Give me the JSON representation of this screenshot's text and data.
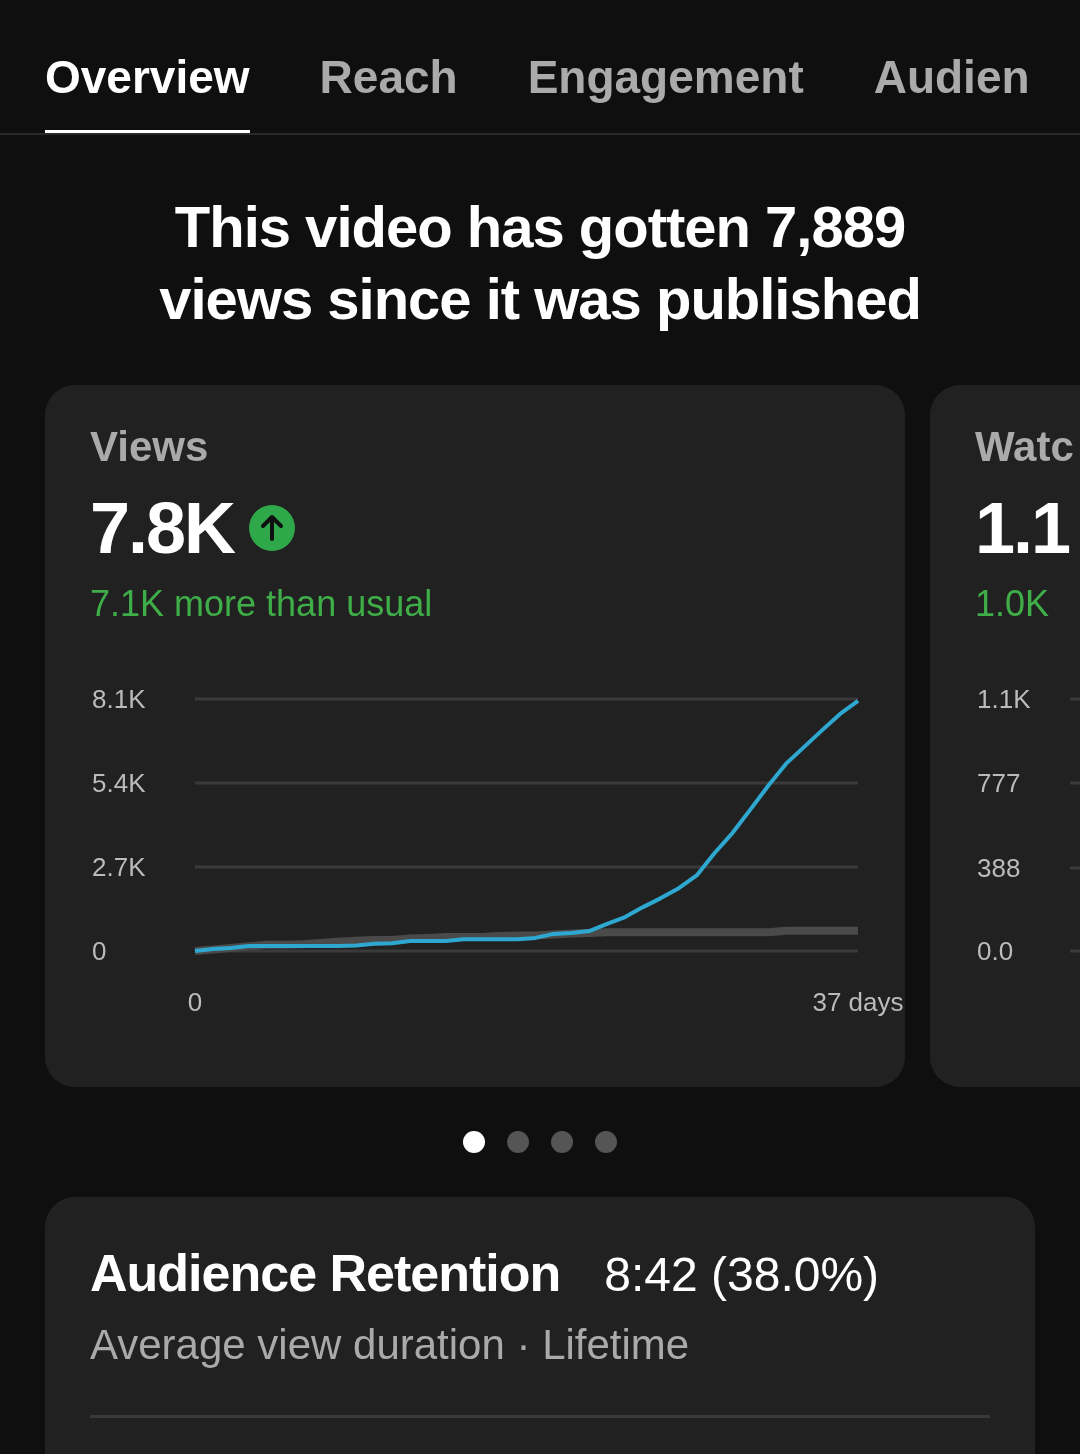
{
  "tabs": [
    {
      "label": "Overview",
      "selected": true
    },
    {
      "label": "Reach",
      "selected": false
    },
    {
      "label": "Engagement",
      "selected": false
    },
    {
      "label": "Audien",
      "selected": false
    }
  ],
  "headline": "This video has gotten 7,889 views since it was published",
  "cards": [
    {
      "title": "Views",
      "value": "7.8K",
      "rising": true,
      "comparison": "7.1K more than usual",
      "chart_data": {
        "type": "line",
        "x": [
          0,
          1,
          2,
          3,
          4,
          5,
          6,
          7,
          8,
          9,
          10,
          11,
          12,
          13,
          14,
          15,
          16,
          17,
          18,
          19,
          20,
          21,
          22,
          23,
          24,
          25,
          26,
          27,
          28,
          29,
          30,
          31,
          32,
          33,
          34,
          35,
          36,
          37
        ],
        "xlim": [
          0,
          37
        ],
        "ylim": [
          0,
          8100
        ],
        "xticks": [
          {
            "value": 0,
            "label": "0"
          },
          {
            "value": 37,
            "label": "37 days"
          }
        ],
        "yticks": [
          {
            "value": 0,
            "label": "0"
          },
          {
            "value": 2700,
            "label": "2.7K"
          },
          {
            "value": 5400,
            "label": "5.4K"
          },
          {
            "value": 8100,
            "label": "8.1K"
          }
        ],
        "series": [
          {
            "color": "#4a4a4a",
            "values": [
              0,
              50,
              100,
              150,
              200,
              200,
              220,
              260,
              300,
              330,
              350,
              350,
              400,
              420,
              450,
              450,
              450,
              480,
              500,
              500,
              530,
              560,
              580,
              600,
              600,
              600,
              600,
              600,
              600,
              600,
              600,
              600,
              600,
              650,
              650,
              650,
              650,
              650
            ]
          },
          {
            "color": "#2ea8d0",
            "values": [
              0,
              60,
              100,
              160,
              160,
              160,
              160,
              160,
              160,
              180,
              230,
              250,
              320,
              320,
              320,
              380,
              380,
              380,
              380,
              420,
              550,
              580,
              640,
              870,
              1090,
              1410,
              1700,
              2020,
              2430,
              3150,
              3800,
              4550,
              5320,
              6030,
              6560,
              7100,
              7620,
              8040
            ]
          }
        ]
      }
    },
    {
      "title": "Watc",
      "value": "1.1",
      "rising": false,
      "comparison": "1.0K",
      "axis_labels": [
        "1.1K",
        "777",
        "388",
        "0.0"
      ]
    }
  ],
  "pager": [
    {
      "selected": true
    },
    {
      "selected": false
    },
    {
      "selected": false
    },
    {
      "selected": false
    }
  ],
  "retention": {
    "title": "Audience Retention",
    "value": "8:42 (38.0%)",
    "subtitle": "Average view duration · Lifetime"
  }
}
